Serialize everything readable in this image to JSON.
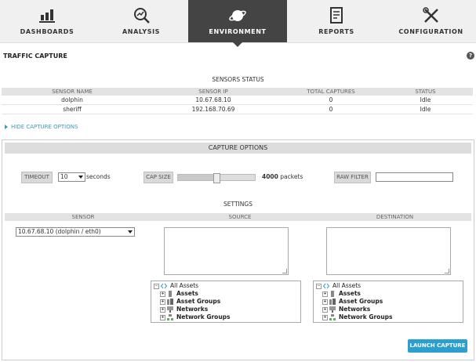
{
  "nav": [
    {
      "label": "DASHBOARDS",
      "icon": "bar-chart-icon"
    },
    {
      "label": "ANALYSIS",
      "icon": "magnifier-chart-icon"
    },
    {
      "label": "ENVIRONMENT",
      "icon": "planet-icon"
    },
    {
      "label": "REPORTS",
      "icon": "document-icon"
    },
    {
      "label": "CONFIGURATION",
      "icon": "tools-icon"
    }
  ],
  "page": {
    "title": "TRAFFIC CAPTURE",
    "help": "?"
  },
  "sensors_status": {
    "title": "SENSORS STATUS",
    "columns": [
      "SENSOR NAME",
      "SENSOR IP",
      "TOTAL CAPTURES",
      "STATUS"
    ],
    "rows": [
      {
        "name": "dolphin",
        "ip": "10.67.68.10",
        "captures": "0",
        "status": "Idle"
      },
      {
        "name": "sheriff",
        "ip": "192.168.70.69",
        "captures": "0",
        "status": "Idle"
      }
    ]
  },
  "toggle_label": "HIDE CAPTURE OPTIONS",
  "capture_options": {
    "title": "CAPTURE OPTIONS",
    "timeout_label": "TIMEOUT",
    "timeout_value": "10",
    "timeout_unit": "seconds",
    "cap_size_label": "CAP SIZE",
    "cap_size_value": "4000",
    "cap_size_unit": "packets",
    "cap_size_fraction": 0.5,
    "raw_filter_label": "RAW FILTER",
    "raw_filter_value": ""
  },
  "settings": {
    "title": "SETTINGS",
    "columns": [
      "SENSOR",
      "SOURCE",
      "DESTINATION"
    ],
    "sensor_selected": "10.67.68.10 (dolphin / eth0)",
    "source_tree": [
      "All Assets",
      "Assets",
      "Asset Groups",
      "Networks",
      "Network Groups"
    ],
    "destination_tree": [
      "All Assets",
      "Assets",
      "Asset Groups",
      "Networks",
      "Network Groups"
    ]
  },
  "launch_label": "LAUNCH CAPTURE",
  "colors": {
    "nav_active": "#444444",
    "accent": "#2a9fd0",
    "link": "#3a9bb9"
  }
}
